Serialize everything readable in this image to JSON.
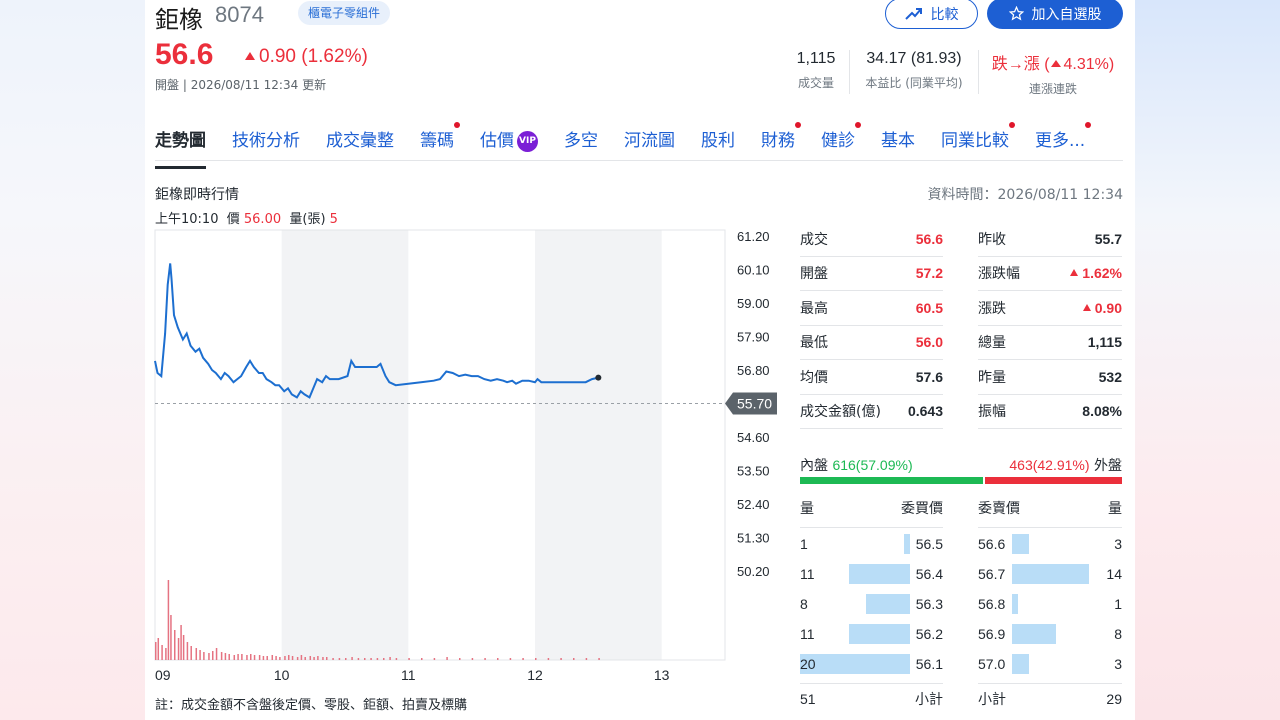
{
  "stock": {
    "name": "鉅橡",
    "code": "8074",
    "sector_tag": "櫃電子零組件",
    "price": "56.6",
    "change": "0.90 (1.62%)",
    "open_label": "開盤",
    "datetime": "2026/08/11 12:34",
    "update_label": "更新"
  },
  "buttons": {
    "compare": "比較",
    "add_watchlist": "加入自選股"
  },
  "summary": [
    {
      "value": "1,115",
      "label": "成交量"
    },
    {
      "value": "34.17 (81.93)",
      "label": "本益比 (同業平均)"
    },
    {
      "value_prefix": "跌→漲 (",
      "value_num": "4.31%)",
      "label": "連漲連跌"
    }
  ],
  "tabs": [
    "走勢圖",
    "技術分析",
    "成交彙整",
    "籌碼",
    "估價",
    "多空",
    "河流圖",
    "股利",
    "財務",
    "健診",
    "基本",
    "同業比較",
    "更多..."
  ],
  "vip_label": "VIP",
  "section": {
    "title": "鉅橡即時行情",
    "data_time": "資料時間：2026/08/11 12:34",
    "hover_time": "上午10:10",
    "hover_price_label": "價",
    "hover_price": "56.00",
    "hover_vol_label": "量(張)",
    "hover_vol": "5"
  },
  "chart_data": {
    "type": "line",
    "x_ticks": [
      "09",
      "10",
      "11",
      "12",
      "13"
    ],
    "y_ticks": [
      "61.20",
      "60.10",
      "59.00",
      "57.90",
      "56.80",
      "55.70",
      "54.60",
      "53.50",
      "52.40",
      "51.30",
      "50.20"
    ],
    "reference_price": 55.7,
    "ylim": [
      50.2,
      61.2
    ],
    "price_series": [
      [
        9.0,
        57.1
      ],
      [
        9.02,
        56.7
      ],
      [
        9.05,
        56.6
      ],
      [
        9.08,
        58.0
      ],
      [
        9.1,
        59.6
      ],
      [
        9.12,
        60.3
      ],
      [
        9.13,
        59.8
      ],
      [
        9.15,
        58.6
      ],
      [
        9.18,
        58.2
      ],
      [
        9.22,
        57.8
      ],
      [
        9.25,
        58.0
      ],
      [
        9.28,
        57.6
      ],
      [
        9.32,
        57.4
      ],
      [
        9.35,
        57.5
      ],
      [
        9.38,
        57.2
      ],
      [
        9.42,
        57.0
      ],
      [
        9.45,
        56.8
      ],
      [
        9.48,
        56.7
      ],
      [
        9.52,
        56.5
      ],
      [
        9.55,
        56.7
      ],
      [
        9.58,
        56.6
      ],
      [
        9.62,
        56.4
      ],
      [
        9.65,
        56.5
      ],
      [
        9.68,
        56.6
      ],
      [
        9.72,
        56.9
      ],
      [
        9.75,
        57.1
      ],
      [
        9.78,
        56.9
      ],
      [
        9.82,
        56.7
      ],
      [
        9.85,
        56.7
      ],
      [
        9.88,
        56.5
      ],
      [
        9.92,
        56.4
      ],
      [
        9.95,
        56.3
      ],
      [
        9.98,
        56.3
      ],
      [
        10.02,
        56.1
      ],
      [
        10.05,
        56.2
      ],
      [
        10.08,
        56.0
      ],
      [
        10.12,
        55.9
      ],
      [
        10.15,
        56.1
      ],
      [
        10.18,
        56.0
      ],
      [
        10.22,
        55.9
      ],
      [
        10.25,
        56.2
      ],
      [
        10.28,
        56.5
      ],
      [
        10.32,
        56.4
      ],
      [
        10.35,
        56.6
      ],
      [
        10.38,
        56.5
      ],
      [
        10.42,
        56.5
      ],
      [
        10.45,
        56.5
      ],
      [
        10.52,
        56.6
      ],
      [
        10.55,
        57.1
      ],
      [
        10.58,
        56.9
      ],
      [
        10.62,
        56.9
      ],
      [
        10.65,
        56.9
      ],
      [
        10.72,
        56.9
      ],
      [
        10.75,
        56.9
      ],
      [
        10.78,
        57.0
      ],
      [
        10.82,
        56.6
      ],
      [
        10.85,
        56.4
      ],
      [
        10.9,
        56.3
      ],
      [
        11.0,
        56.35
      ],
      [
        11.1,
        56.4
      ],
      [
        11.2,
        56.45
      ],
      [
        11.25,
        56.5
      ],
      [
        11.3,
        56.75
      ],
      [
        11.35,
        56.7
      ],
      [
        11.4,
        56.6
      ],
      [
        11.45,
        56.65
      ],
      [
        11.5,
        56.6
      ],
      [
        11.55,
        56.6
      ],
      [
        11.6,
        56.5
      ],
      [
        11.65,
        56.45
      ],
      [
        11.7,
        56.5
      ],
      [
        11.75,
        56.45
      ],
      [
        11.78,
        56.4
      ],
      [
        11.82,
        56.45
      ],
      [
        11.85,
        56.35
      ],
      [
        11.9,
        56.45
      ],
      [
        11.95,
        56.45
      ],
      [
        12.0,
        56.4
      ],
      [
        12.02,
        56.5
      ],
      [
        12.05,
        56.4
      ],
      [
        12.1,
        56.4
      ],
      [
        12.2,
        56.4
      ],
      [
        12.3,
        56.4
      ],
      [
        12.4,
        56.4
      ],
      [
        12.45,
        56.5
      ],
      [
        12.5,
        56.55
      ]
    ],
    "volume_series": [
      [
        9.0,
        18
      ],
      [
        9.02,
        22
      ],
      [
        9.05,
        15
      ],
      [
        9.08,
        12
      ],
      [
        9.1,
        80
      ],
      [
        9.12,
        45
      ],
      [
        9.15,
        30
      ],
      [
        9.18,
        22
      ],
      [
        9.2,
        35
      ],
      [
        9.22,
        25
      ],
      [
        9.25,
        18
      ],
      [
        9.28,
        14
      ],
      [
        9.32,
        12
      ],
      [
        9.35,
        10
      ],
      [
        9.38,
        8
      ],
      [
        9.42,
        7
      ],
      [
        9.45,
        9
      ],
      [
        9.48,
        12
      ],
      [
        9.52,
        8
      ],
      [
        9.55,
        7
      ],
      [
        9.58,
        6
      ],
      [
        9.62,
        5
      ],
      [
        9.65,
        6
      ],
      [
        9.68,
        6
      ],
      [
        9.72,
        5
      ],
      [
        9.75,
        6
      ],
      [
        9.78,
        5
      ],
      [
        9.82,
        5
      ],
      [
        9.85,
        4
      ],
      [
        9.88,
        4
      ],
      [
        9.92,
        5
      ],
      [
        9.95,
        4
      ],
      [
        9.98,
        3
      ],
      [
        10.02,
        4
      ],
      [
        10.05,
        5
      ],
      [
        10.08,
        4
      ],
      [
        10.12,
        3
      ],
      [
        10.15,
        5
      ],
      [
        10.18,
        3
      ],
      [
        10.22,
        4
      ],
      [
        10.25,
        3
      ],
      [
        10.28,
        4
      ],
      [
        10.32,
        3
      ],
      [
        10.35,
        3
      ],
      [
        10.4,
        2
      ],
      [
        10.45,
        2
      ],
      [
        10.5,
        2
      ],
      [
        10.55,
        3
      ],
      [
        10.6,
        2
      ],
      [
        10.65,
        2
      ],
      [
        10.7,
        2
      ],
      [
        10.75,
        2
      ],
      [
        10.8,
        2
      ],
      [
        10.85,
        3
      ],
      [
        10.9,
        2
      ],
      [
        11.0,
        2
      ],
      [
        11.1,
        2
      ],
      [
        11.2,
        2
      ],
      [
        11.3,
        3
      ],
      [
        11.4,
        2
      ],
      [
        11.5,
        2
      ],
      [
        11.6,
        2
      ],
      [
        11.7,
        2
      ],
      [
        11.8,
        2
      ],
      [
        11.9,
        2
      ],
      [
        12.0,
        2
      ],
      [
        12.1,
        2
      ],
      [
        12.2,
        2
      ],
      [
        12.3,
        2
      ],
      [
        12.4,
        2
      ],
      [
        12.5,
        2
      ]
    ]
  },
  "quote_left": [
    {
      "k": "成交",
      "v": "56.6",
      "c": "red"
    },
    {
      "k": "開盤",
      "v": "57.2",
      "c": "red"
    },
    {
      "k": "最高",
      "v": "60.5",
      "c": "red"
    },
    {
      "k": "最低",
      "v": "56.0",
      "c": "red"
    },
    {
      "k": "均價",
      "v": "57.6",
      "c": "black"
    },
    {
      "k": "成交金額(億)",
      "v": "0.643",
      "c": "black"
    }
  ],
  "quote_right": [
    {
      "k": "昨收",
      "v": "55.7",
      "c": "black"
    },
    {
      "k": "漲跌幅",
      "v": "1.62%",
      "c": "red",
      "up": true
    },
    {
      "k": "漲跌",
      "v": "0.90",
      "c": "red",
      "up": true
    },
    {
      "k": "總量",
      "v": "1,115",
      "c": "black"
    },
    {
      "k": "昨量",
      "v": "532",
      "c": "black"
    },
    {
      "k": "振幅",
      "v": "8.08%",
      "c": "black"
    }
  ],
  "inout": {
    "in_label": "內盤",
    "in_value": "616(57.09%)",
    "out_value": "463(42.91%)",
    "out_label": "外盤",
    "in_fraction": 0.5709
  },
  "orderbook": {
    "headers": {
      "bid_qty": "量",
      "bid_price": "委買價",
      "ask_price": "委賣價",
      "ask_qty": "量"
    },
    "bids": [
      {
        "q": "1",
        "p": "56.5"
      },
      {
        "q": "11",
        "p": "56.4"
      },
      {
        "q": "8",
        "p": "56.3"
      },
      {
        "q": "11",
        "p": "56.2"
      },
      {
        "q": "20",
        "p": "56.1"
      }
    ],
    "asks": [
      {
        "p": "56.6",
        "q": "3"
      },
      {
        "p": "56.7",
        "q": "14"
      },
      {
        "p": "56.8",
        "q": "1"
      },
      {
        "p": "56.9",
        "q": "8"
      },
      {
        "p": "57.0",
        "q": "3"
      }
    ],
    "bid_total_label": "小計",
    "bid_total": "51",
    "ask_total_label": "小計",
    "ask_total": "29"
  },
  "footnote": "註：成交金額不含盤後定價、零股、鉅額、拍賣及標購"
}
